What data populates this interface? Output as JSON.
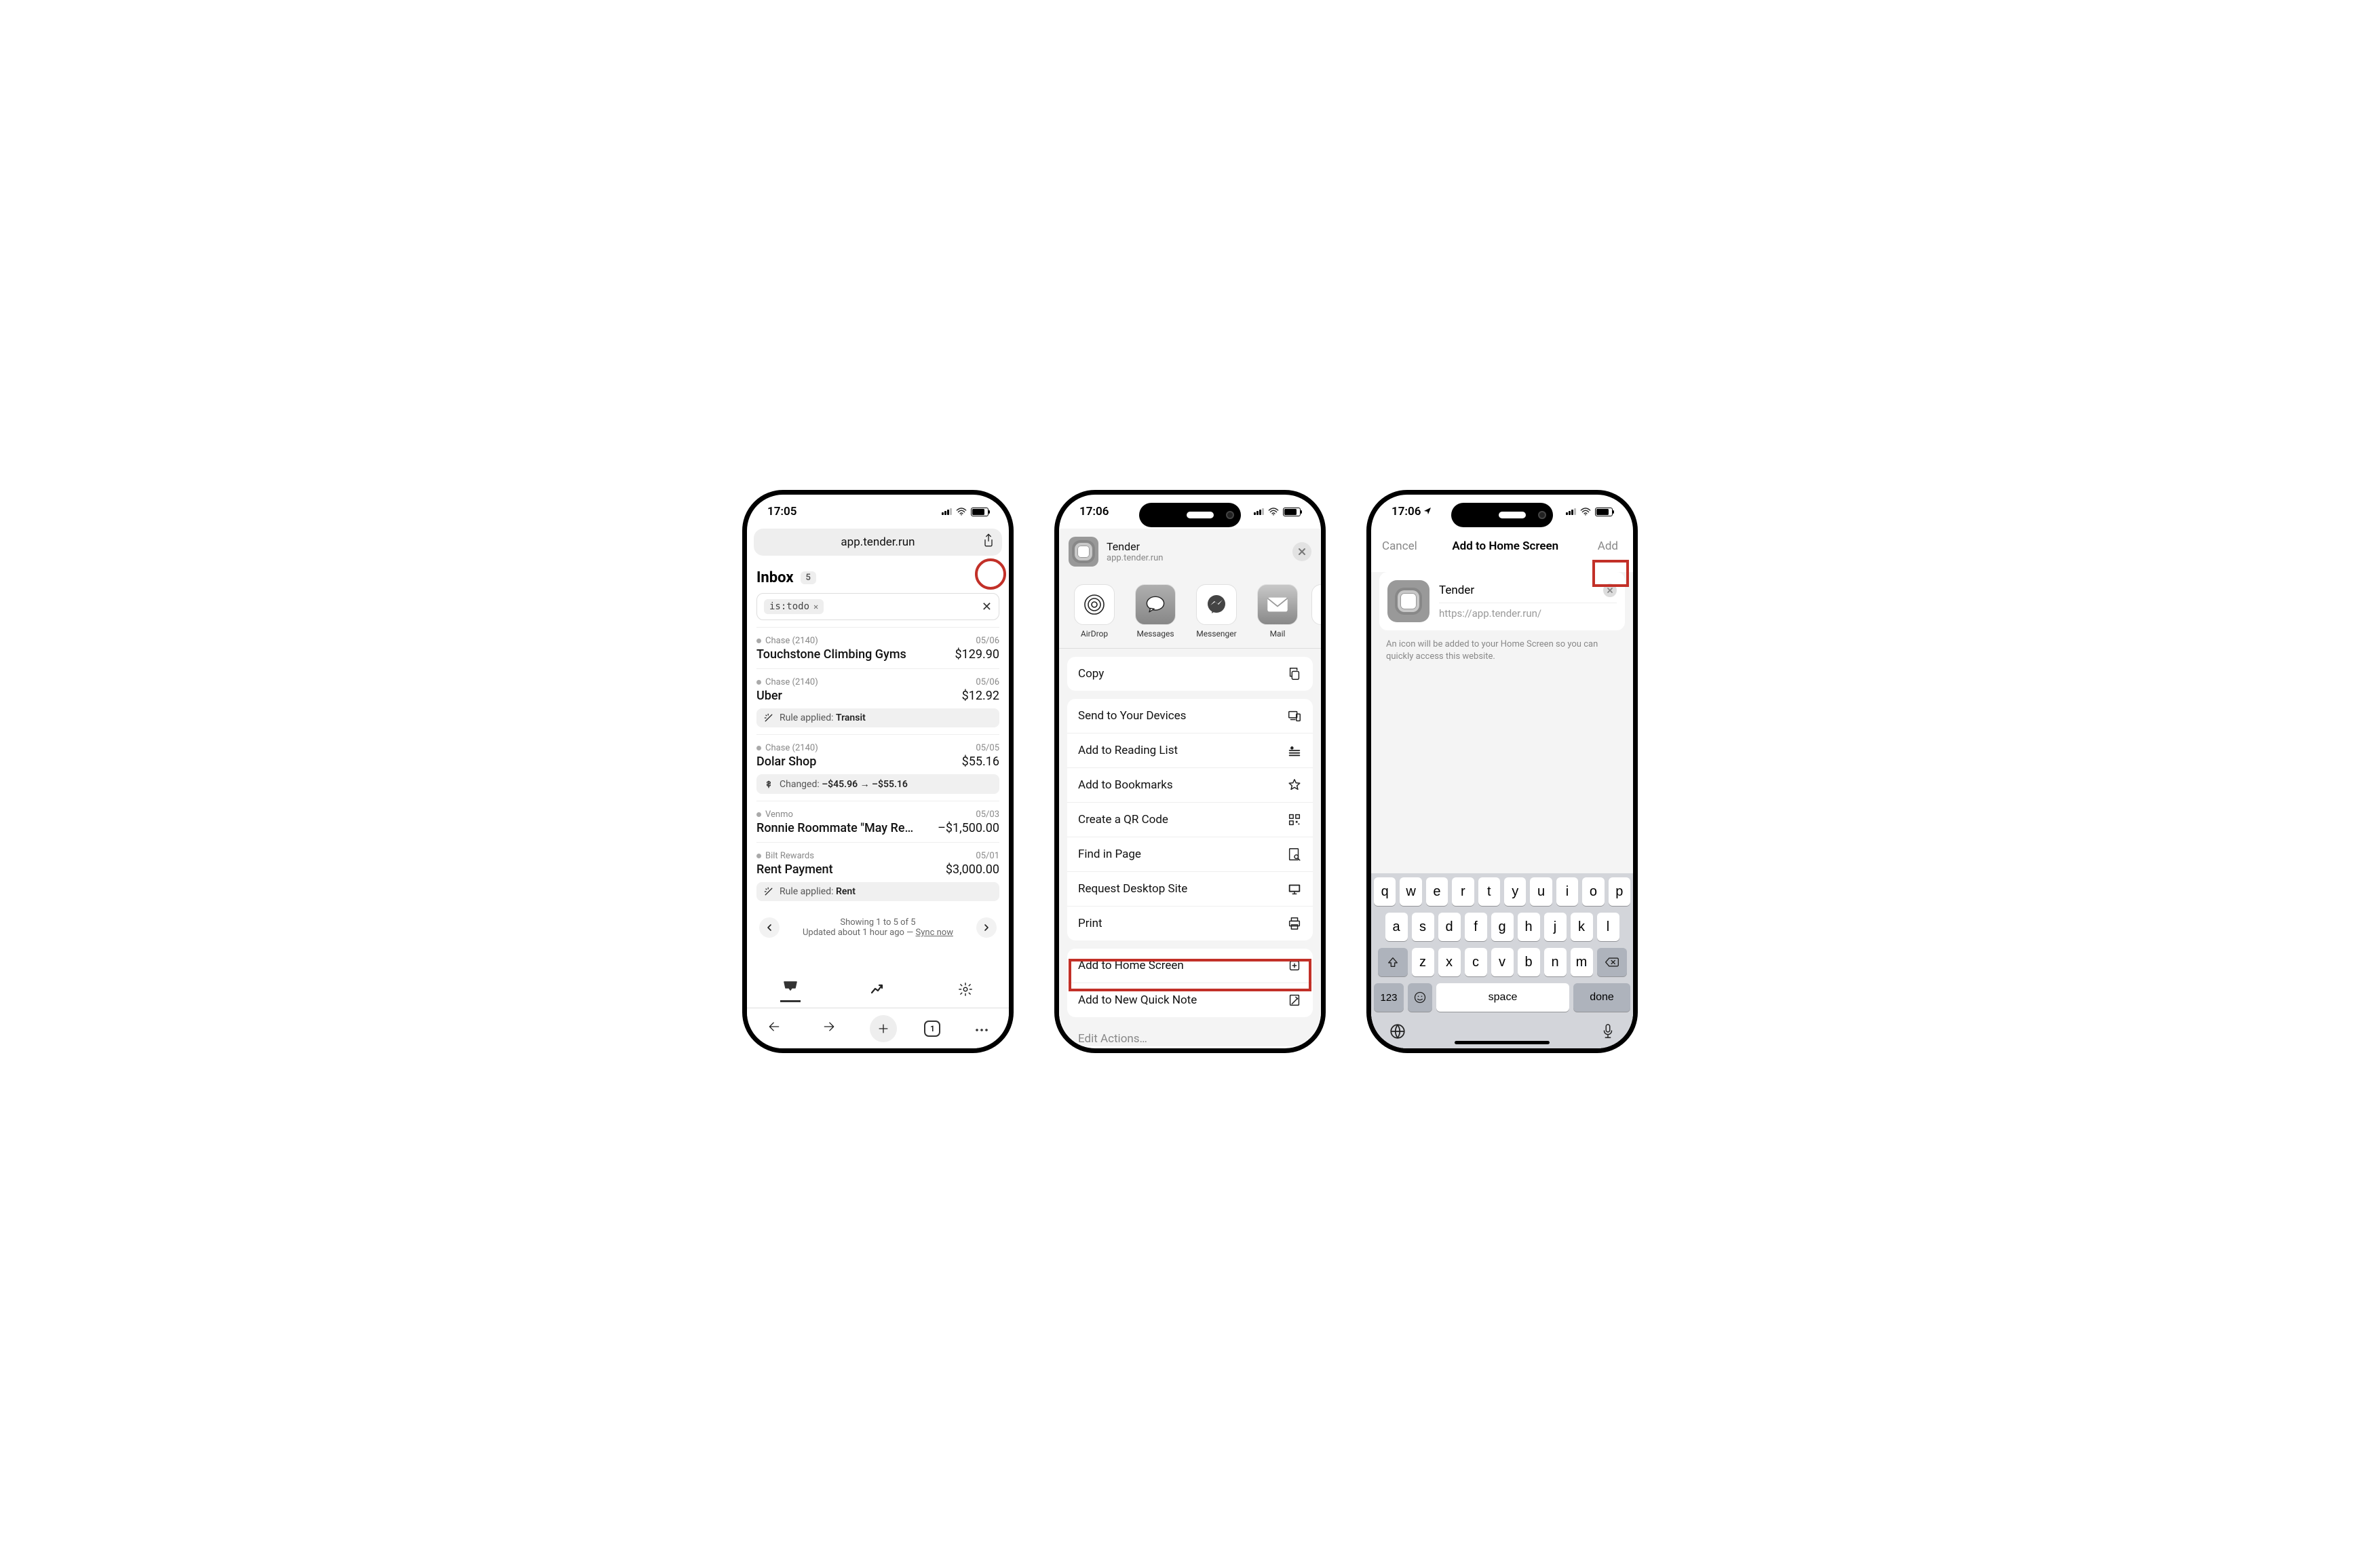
{
  "phone1": {
    "time": "17:05",
    "url": "app.tender.run",
    "inbox_label": "Inbox",
    "inbox_count": "5",
    "filter_chip": "is:todo",
    "transactions": [
      {
        "source": "Chase (2140)",
        "date": "05/06",
        "title": "Touchstone Climbing Gyms",
        "amount": "$129.90"
      },
      {
        "source": "Chase (2140)",
        "date": "05/06",
        "title": "Uber",
        "amount": "$12.92",
        "rule_prefix": "Rule applied:",
        "rule_value": "Transit"
      },
      {
        "source": "Chase (2140)",
        "date": "05/05",
        "title": "Dolar Shop",
        "amount": "$55.16",
        "change_prefix": "Changed:",
        "change_value": "–$45.96 → –$55.16"
      },
      {
        "source": "Venmo",
        "date": "05/03",
        "title": "Ronnie Roommate \"May Re…",
        "amount": "–$1,500.00"
      },
      {
        "source": "Bilt Rewards",
        "date": "05/01",
        "title": "Rent Payment",
        "amount": "$3,000.00",
        "rule_prefix": "Rule applied:",
        "rule_value": "Rent"
      }
    ],
    "pager_line1": "Showing 1 to 5 of 5",
    "pager_line2": "Updated about 1 hour ago — ",
    "sync_now": "Sync now",
    "tab_count": "1"
  },
  "phone2": {
    "time": "17:06",
    "app_name": "Tender",
    "app_url": "app.tender.run",
    "share_apps": [
      {
        "label": "AirDrop"
      },
      {
        "label": "Messages"
      },
      {
        "label": "Messenger"
      },
      {
        "label": "Mail"
      }
    ],
    "group1": [
      "Copy"
    ],
    "group2": [
      "Send to Your Devices",
      "Add to Reading List",
      "Add to Bookmarks",
      "Create a QR Code",
      "Find in Page",
      "Request Desktop Site",
      "Print"
    ],
    "group3": [
      "Add to Home Screen",
      "Add to New Quick Note"
    ],
    "edit_actions": "Edit Actions…"
  },
  "phone3": {
    "time": "17:06",
    "cancel": "Cancel",
    "title": "Add to Home Screen",
    "add": "Add",
    "name": "Tender",
    "url": "https://app.tender.run/",
    "help": "An icon will be added to your Home Screen so you can quickly access this website.",
    "kb_rows": [
      [
        "q",
        "w",
        "e",
        "r",
        "t",
        "y",
        "u",
        "i",
        "o",
        "p"
      ],
      [
        "a",
        "s",
        "d",
        "f",
        "g",
        "h",
        "j",
        "k",
        "l"
      ],
      [
        "z",
        "x",
        "c",
        "v",
        "b",
        "n",
        "m"
      ]
    ],
    "num_key": "123",
    "space": "space",
    "done": "done"
  }
}
